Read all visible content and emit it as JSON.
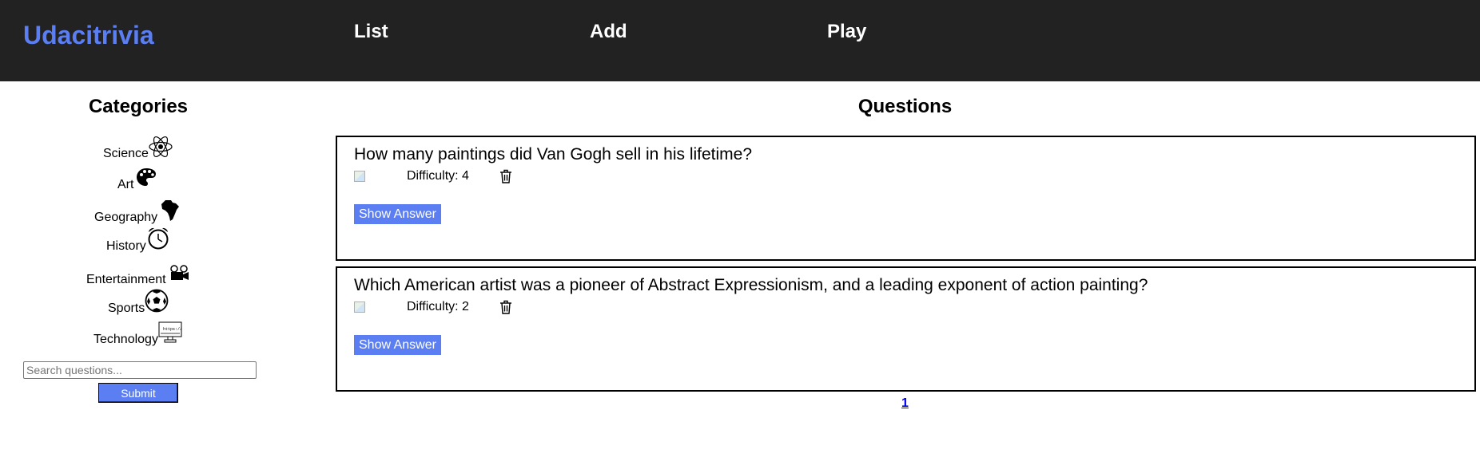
{
  "header": {
    "brand": "Udacitrivia",
    "nav": [
      "List",
      "Add",
      "Play"
    ],
    "accent_color": "#5b7ff2",
    "background_color": "#222222"
  },
  "sidebar": {
    "title": "Categories",
    "categories": [
      {
        "label": "Science",
        "icon": "atom-icon"
      },
      {
        "label": "Art",
        "icon": "palette-icon"
      },
      {
        "label": "Geography",
        "icon": "africa-map-icon"
      },
      {
        "label": "History",
        "icon": "alarm-clock-icon"
      },
      {
        "label": "Entertainment",
        "icon": "film-camera-icon"
      },
      {
        "label": "Sports",
        "icon": "soccer-ball-icon"
      },
      {
        "label": "Technology",
        "icon": "computer-monitor-icon"
      }
    ],
    "search": {
      "placeholder": "Search questions...",
      "value": ""
    },
    "submit_label": "Submit"
  },
  "main": {
    "title": "Questions",
    "questions": [
      {
        "text": "How many paintings did Van Gogh sell in his lifetime?",
        "difficulty": "Difficulty: 4",
        "show_answer_label": "Show Answer"
      },
      {
        "text": "Which American artist was a pioneer of Abstract Expressionism, and a leading exponent of action painting?",
        "difficulty": "Difficulty: 2",
        "show_answer_label": "Show Answer"
      }
    ],
    "pagination": [
      "1"
    ]
  }
}
